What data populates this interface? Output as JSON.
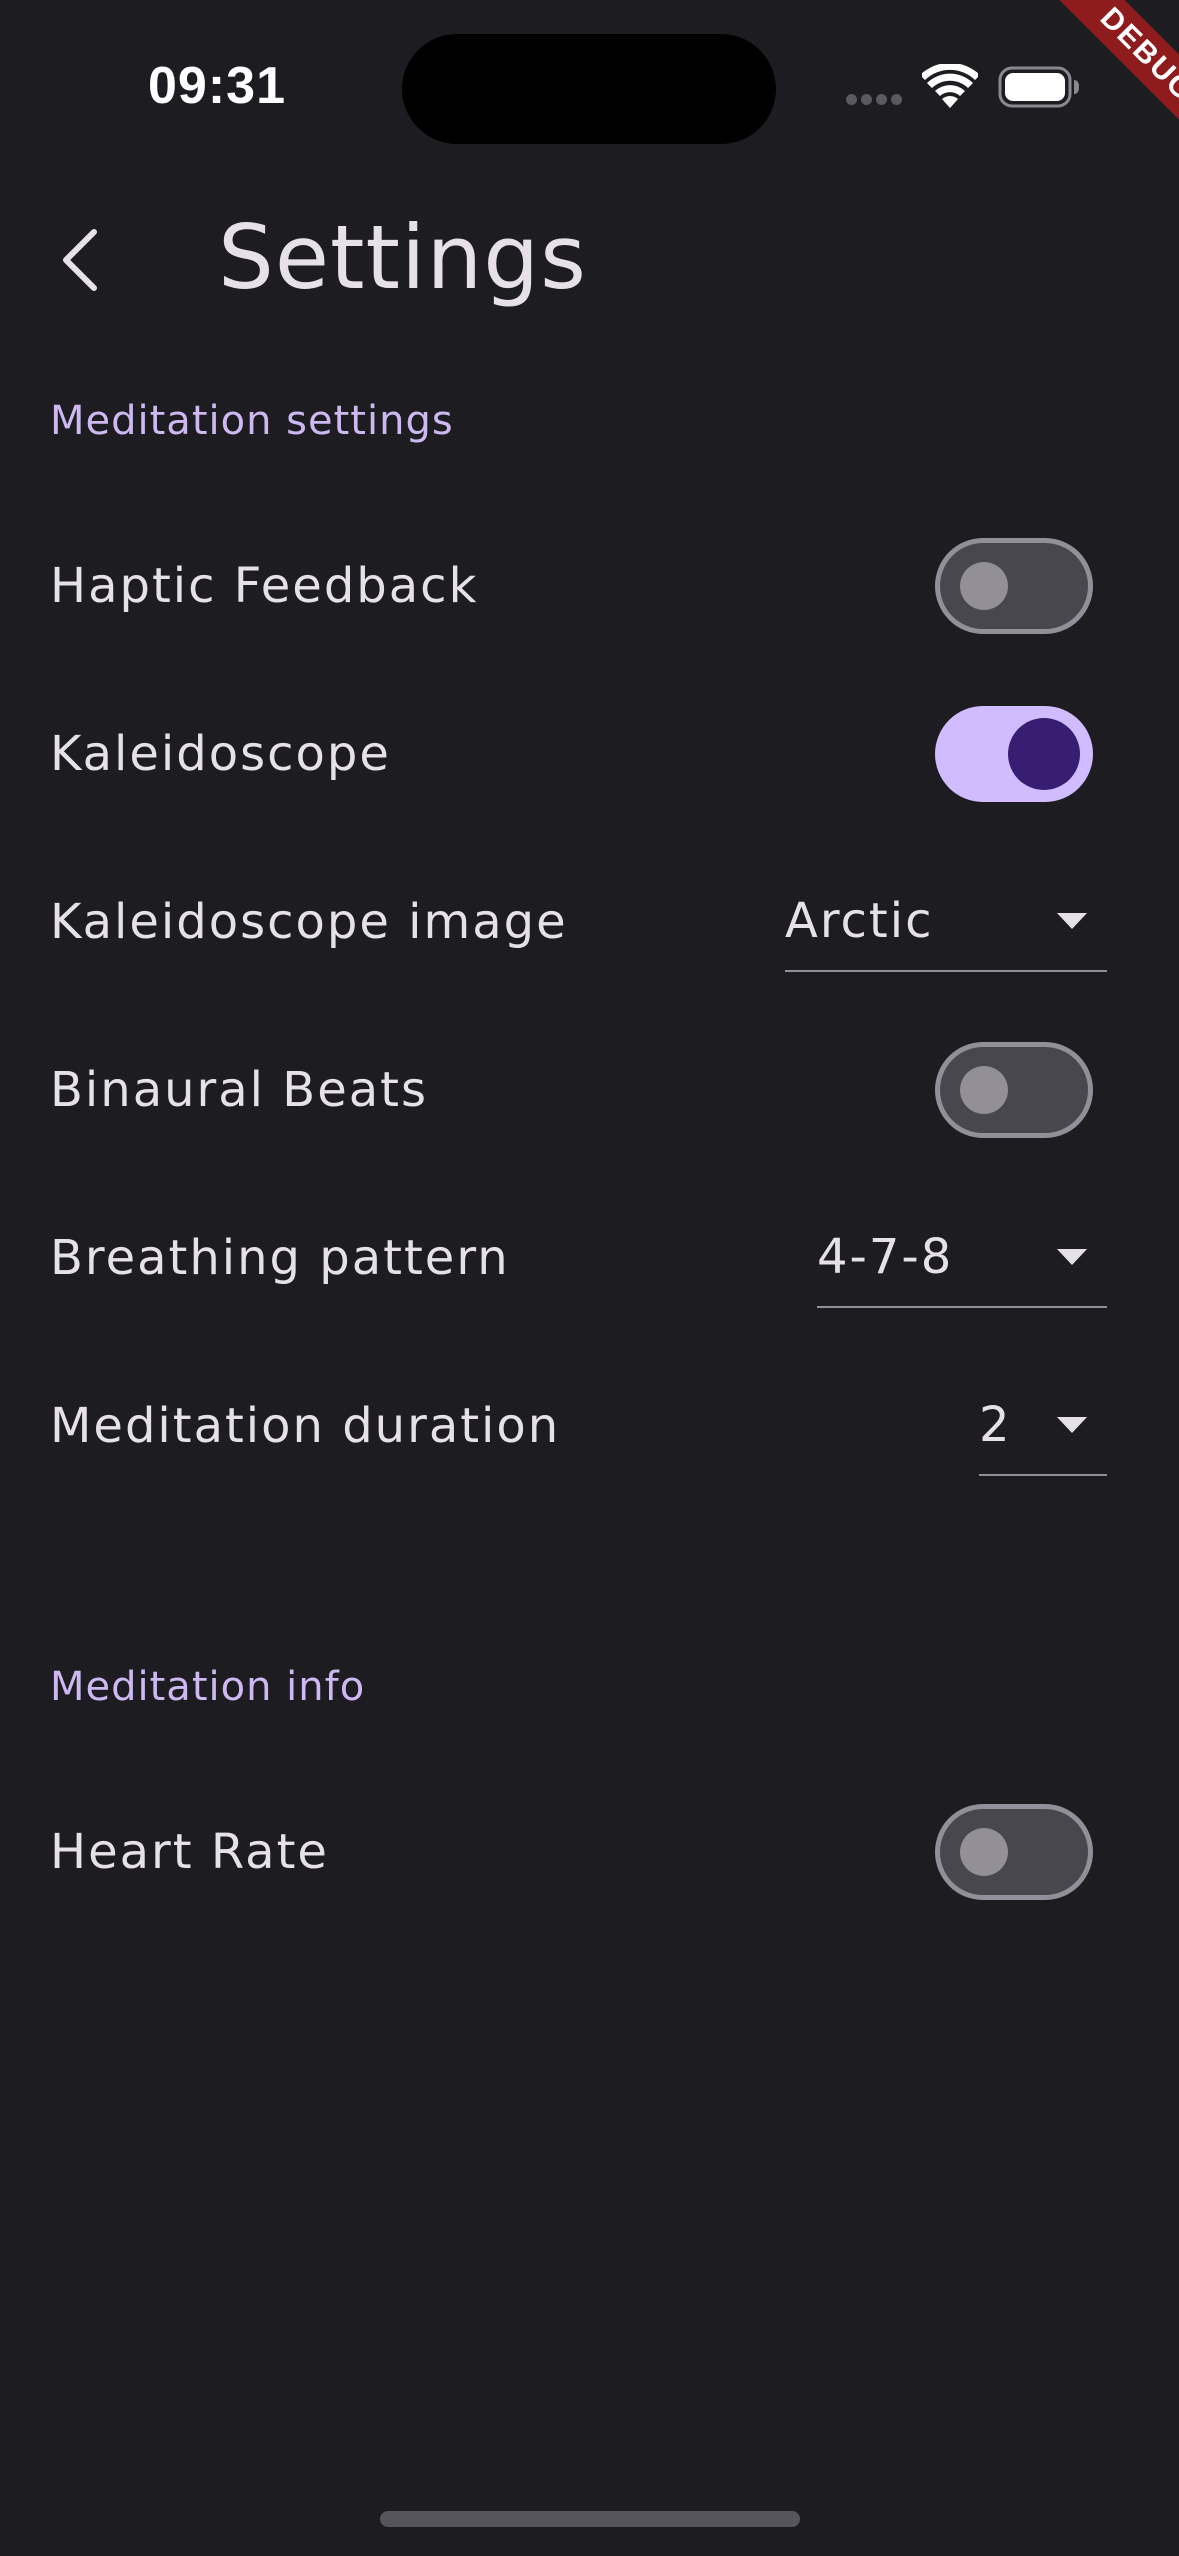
{
  "status_bar": {
    "time": "09:31"
  },
  "debug_banner": "DEBUG",
  "app_bar": {
    "title": "Settings",
    "back_icon": "chevron-left-icon"
  },
  "sections": {
    "meditation_settings": {
      "header": "Meditation settings",
      "haptic_feedback": {
        "label": "Haptic Feedback",
        "enabled": false
      },
      "kaleidoscope": {
        "label": "Kaleidoscope",
        "enabled": true
      },
      "kaleidoscope_image": {
        "label": "Kaleidoscope image",
        "value": "Arctic"
      },
      "binaural_beats": {
        "label": "Binaural Beats",
        "enabled": false
      },
      "breathing_pattern": {
        "label": "Breathing pattern",
        "value": "4-7-8"
      },
      "meditation_duration": {
        "label": "Meditation duration",
        "value": "2"
      }
    },
    "meditation_info": {
      "header": "Meditation info",
      "heart_rate": {
        "label": "Heart Rate",
        "enabled": false
      }
    }
  },
  "colors": {
    "background": "#1d1c21",
    "accent": "#d0bcff",
    "section_header": "#cdb8f2",
    "switch_on_knob": "#381e72",
    "switch_off_track": "#48464f",
    "outline": "#938f99",
    "debug_banner": "#8e1c1c"
  }
}
